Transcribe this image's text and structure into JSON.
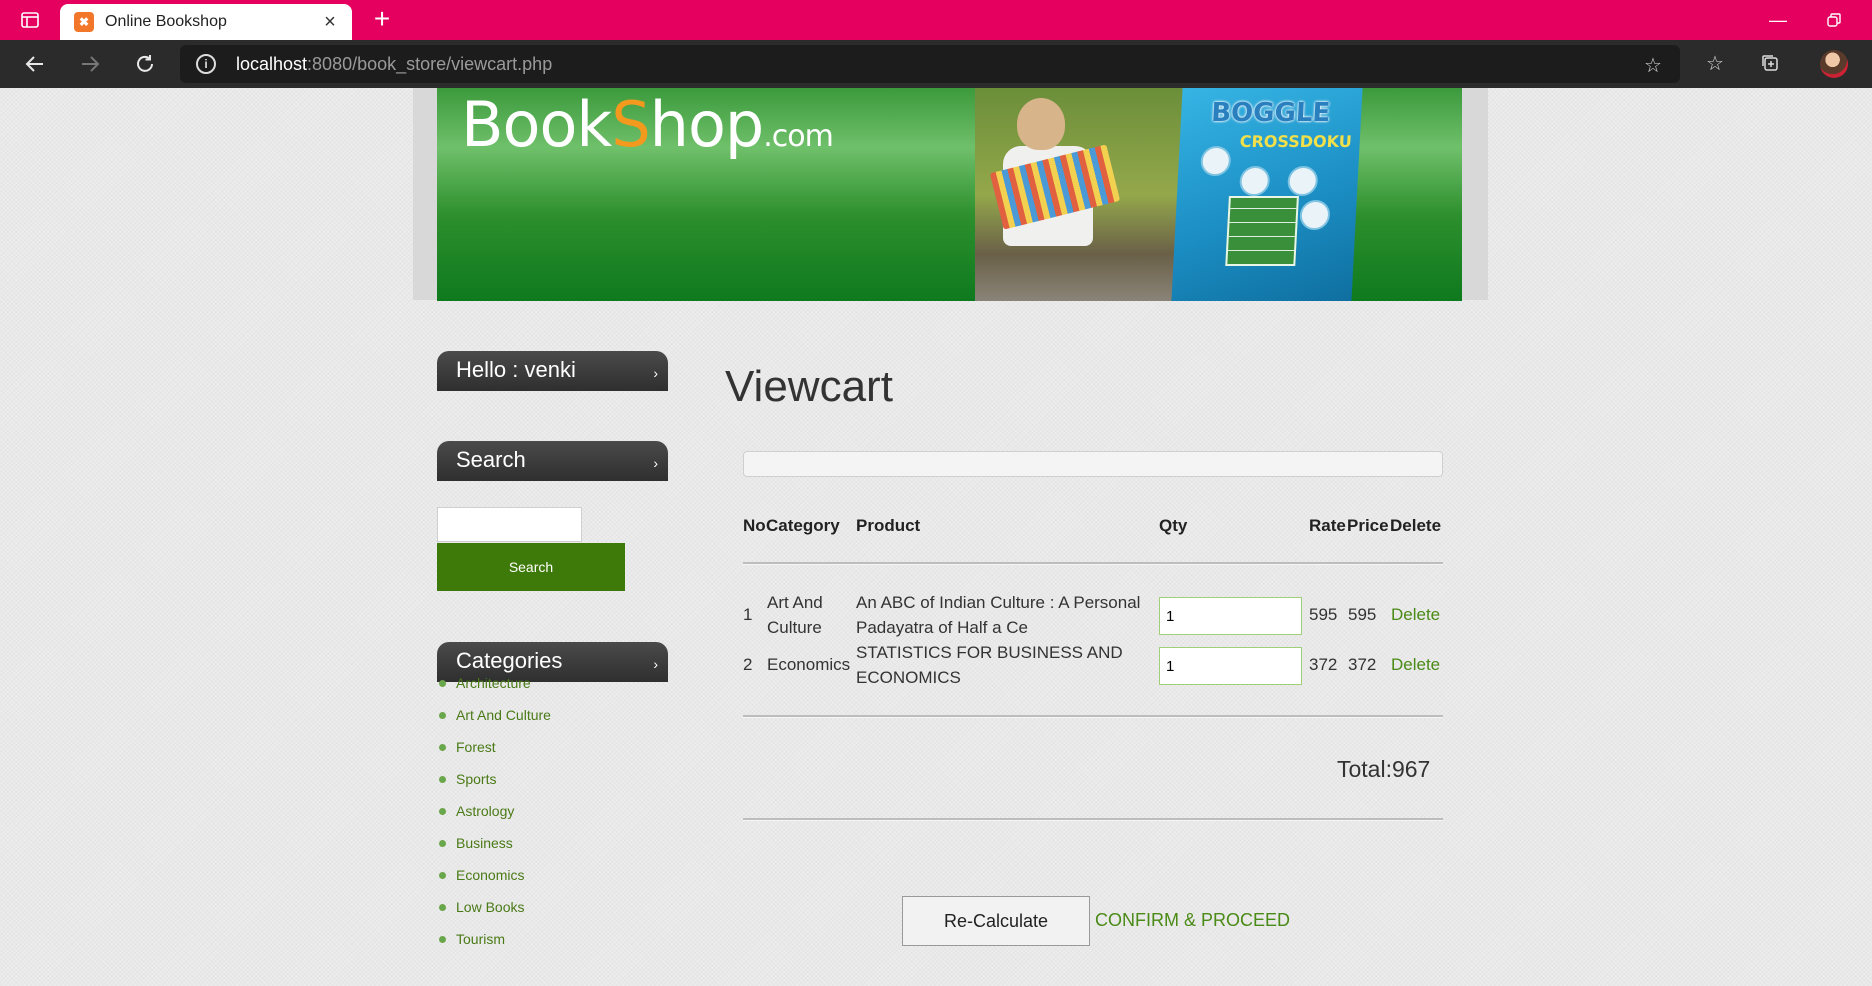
{
  "browser": {
    "tab_title": "Online Bookshop",
    "tab_icon": "xampp-icon",
    "url_host": "localhost",
    "url_rest": ":8080/book_store/viewcart.php",
    "accent": "#e5005f"
  },
  "banner": {
    "logo_book": "Book",
    "logo_s": "S",
    "logo_hop": "hop",
    "logo_com": ".com",
    "book_title": "BOGGLE",
    "book_subtitle": "CROSSDOKU"
  },
  "sidebar": {
    "hello": "Hello : venki",
    "search_heading": "Search",
    "search_button": "Search",
    "search_value": "",
    "categories_heading": "Categories",
    "categories": [
      "Architecture",
      "Art And Culture",
      "Forest",
      "Sports",
      "Astrology",
      "Business",
      "Economics",
      "Low Books",
      "Tourism"
    ]
  },
  "main": {
    "title": "Viewcart",
    "headers": {
      "no": "No",
      "category": "Category",
      "product": "Product",
      "qty": "Qty",
      "rate": "Rate",
      "price": "Price",
      "delete": "Delete"
    },
    "rows": [
      {
        "no": "1",
        "category_line1": "Art And",
        "category_line2": "Culture",
        "product_line1": "An ABC of Indian Culture : A Personal",
        "product_line2": "Padayatra of Half a Ce",
        "qty": "1",
        "rate": "595",
        "price": "595",
        "delete": "Delete"
      },
      {
        "no": "2",
        "category_line1": "Economics",
        "category_line2": "",
        "product_line1": "STATISTICS FOR BUSINESS AND",
        "product_line2": "ECONOMICS",
        "qty": "1",
        "rate": "372",
        "price": "372",
        "delete": "Delete"
      }
    ],
    "total": "Total:967",
    "recalculate": "Re-Calculate",
    "confirm": "CONFIRM & PROCEED",
    "link_color": "#4a8a16",
    "button_green": "#3e7a09"
  }
}
